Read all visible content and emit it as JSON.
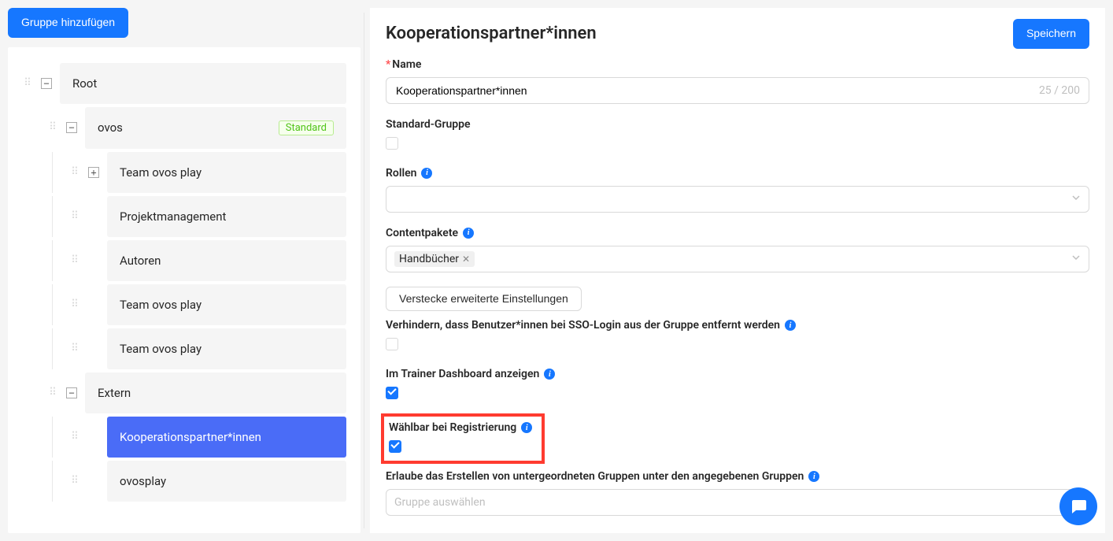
{
  "left": {
    "add_group_label": "Gruppe hinzufügen",
    "tree": {
      "root": {
        "label": "Root"
      },
      "ovos": {
        "label": "ovos",
        "badge": "Standard"
      },
      "team1": {
        "label": "Team ovos play"
      },
      "pm": {
        "label": "Projektmanagement"
      },
      "authors": {
        "label": "Autoren"
      },
      "team2": {
        "label": "Team ovos play"
      },
      "team3": {
        "label": "Team ovos play"
      },
      "extern": {
        "label": "Extern"
      },
      "coop": {
        "label": "Kooperationspartner*innen"
      },
      "ovosplay": {
        "label": "ovosplay"
      }
    }
  },
  "form": {
    "title": "Kooperationspartner*innen",
    "save_label": "Speichern",
    "name_label": "Name",
    "name_value": "Kooperationspartner*innen",
    "name_counter": "25 / 200",
    "standard_group_label": "Standard-Gruppe",
    "standard_group_checked": false,
    "roles_label": "Rollen",
    "content_packages_label": "Contentpakete",
    "content_package_tag": "Handbücher",
    "hide_advanced_label": "Verstecke erweiterte Einstellungen",
    "prevent_sso_label": "Verhindern, dass Benutzer*innen bei SSO-Login aus der Gruppe entfernt werden",
    "prevent_sso_checked": false,
    "trainer_dashboard_label": "Im Trainer Dashboard anzeigen",
    "trainer_dashboard_checked": true,
    "selectable_registration_label": "Wählbar bei Registrierung",
    "selectable_registration_checked": true,
    "allow_subgroups_label": "Erlaube das Erstellen von untergeordneten Gruppen unter den angegebenen Gruppen",
    "allow_subgroups_placeholder": "Gruppe auswählen"
  }
}
